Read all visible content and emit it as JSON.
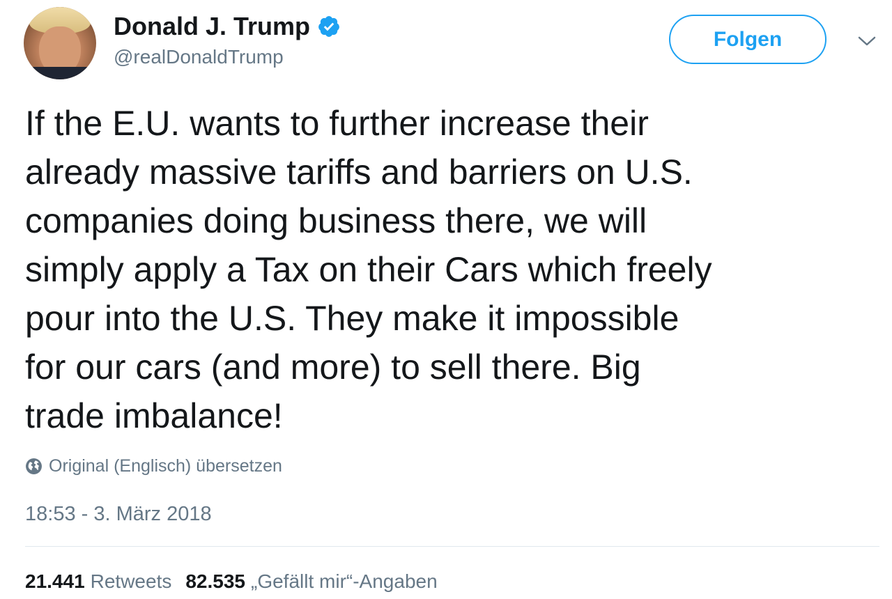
{
  "tweet": {
    "author": {
      "display_name": "Donald J. Trump",
      "handle": "@realDonaldTrump",
      "verified": true
    },
    "follow_button_label": "Folgen",
    "text_lines": [
      "If the E.U. wants to further increase their",
      "already massive tariffs and barriers on U.S.",
      "companies doing business there, we will",
      "simply apply a Tax on their Cars which freely",
      "pour into the U.S. They make it impossible",
      "for our cars (and more) to sell there. Big",
      "trade imbalance!"
    ],
    "translate_label": "Original (Englisch) übersetzen",
    "timestamp": "18:53 - 3. März 2018",
    "stats": {
      "retweets_count": "21.441",
      "retweets_label": "Retweets",
      "likes_count": "82.535",
      "likes_label": "„Gefällt mir“-Angaben"
    }
  },
  "icons": {
    "verified": "verified-badge-icon",
    "caret": "chevron-down-icon",
    "globe": "globe-icon"
  },
  "colors": {
    "accent": "#1da1f2",
    "text": "#14171a",
    "secondary_text": "#657786",
    "divider": "#e1e8ed"
  }
}
